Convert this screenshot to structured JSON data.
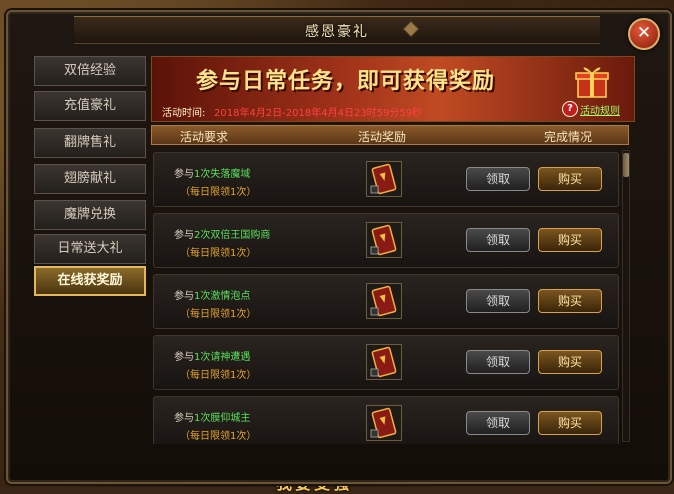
{
  "dialog": {
    "title": "感恩豪礼",
    "close_label": "✕"
  },
  "sidebar": {
    "items": [
      {
        "label": "双倍经验",
        "active": false
      },
      {
        "label": "充值豪礼",
        "active": false
      },
      {
        "label": "翻牌售礼",
        "active": false
      },
      {
        "label": "翅膀献礼",
        "active": false
      },
      {
        "label": "魔牌兑换",
        "active": false
      },
      {
        "label": "日常送大礼",
        "active": false
      },
      {
        "label": "在线获奖励",
        "active": true
      }
    ]
  },
  "banner": {
    "heading": "参与日常任务，即可获得奖励",
    "time_label": "活动时间:",
    "time_value": "2018年4月2日-2018年4月4日23时59分59秒",
    "help_icon": "?",
    "help_link": "活动规则"
  },
  "table": {
    "headers": [
      "活动要求",
      "活动奖励",
      "完成情况"
    ],
    "rows": [
      {
        "prefix": "参与",
        "task": "1次失落魔域",
        "limit": "（每日限领1次）",
        "reward_icon": "reward-card-icon",
        "claim": "领取",
        "buy": "购买"
      },
      {
        "prefix": "参与",
        "task": "2次双倍王国购商",
        "limit": "（每日限领1次）",
        "reward_icon": "reward-card-icon",
        "claim": "领取",
        "buy": "购买"
      },
      {
        "prefix": "参与",
        "task": "1次激情泡点",
        "limit": "（每日限领1次）",
        "reward_icon": "reward-card-icon",
        "claim": "领取",
        "buy": "购买"
      },
      {
        "prefix": "参与",
        "task": "1次请神遭遇",
        "limit": "（每日限领1次）",
        "reward_icon": "reward-card-icon",
        "claim": "领取",
        "buy": "购买"
      },
      {
        "prefix": "参与",
        "task": "1次膜仰城主",
        "limit": "（每日限领1次）",
        "reward_icon": "reward-card-icon",
        "claim": "领取",
        "buy": "购买"
      }
    ]
  },
  "world": {
    "bottom_text": "我要变强"
  },
  "colors": {
    "accent_gold": "#e3b75a",
    "task_green": "#59e05a",
    "limit_orange": "#e6a52a",
    "time_red": "#ff4040"
  }
}
